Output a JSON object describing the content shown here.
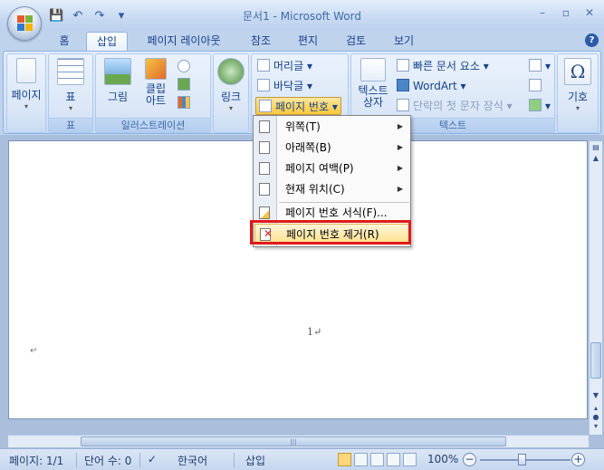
{
  "window": {
    "title": "문서1 - Microsoft Word"
  },
  "quick_access": {
    "save": "💾",
    "undo": "↶",
    "redo": "↷",
    "customize": "▾"
  },
  "tabs": [
    {
      "label": "홈"
    },
    {
      "label": "삽입"
    },
    {
      "label": "페이지 레이아웃"
    },
    {
      "label": "참조"
    },
    {
      "label": "편지"
    },
    {
      "label": "검토"
    },
    {
      "label": "보기"
    }
  ],
  "ribbon": {
    "pages": {
      "label": "페이지"
    },
    "table": {
      "label": "표",
      "group_label": "표"
    },
    "picture": {
      "label": "그림"
    },
    "clipart": {
      "label": "클립\n아트"
    },
    "illustrations_group": "일러스트레이션",
    "link": {
      "label": "링크"
    },
    "header": {
      "label": "머리글"
    },
    "footer": {
      "label": "바닥글"
    },
    "page_number": {
      "label": "페이지 번호"
    },
    "textbox": {
      "label": "텍스트\n상자"
    },
    "quickparts": {
      "label": "빠른 문서 요소"
    },
    "wordart": {
      "label": "WordArt"
    },
    "dropcap": {
      "label": "단락의 첫 문자 장식"
    },
    "text_group": "텍스트",
    "symbol": {
      "label": "기호"
    }
  },
  "menu": {
    "items": [
      {
        "label": "위쪽(T)",
        "submenu": true
      },
      {
        "label": "아래쪽(B)",
        "submenu": true
      },
      {
        "label": "페이지 여백(P)",
        "submenu": true
      },
      {
        "label": "현재 위치(C)",
        "submenu": true
      },
      {
        "label": "페이지 번호 서식(F)..."
      },
      {
        "label": "페이지 번호 제거(R)"
      }
    ]
  },
  "document": {
    "page_number_text": "1↵",
    "paragraph_mark": "↵"
  },
  "status": {
    "page": "페이지: 1/1",
    "words": "단어 수: 0",
    "language": "한국어",
    "insert_mode": "삽입",
    "zoom": "100%"
  }
}
